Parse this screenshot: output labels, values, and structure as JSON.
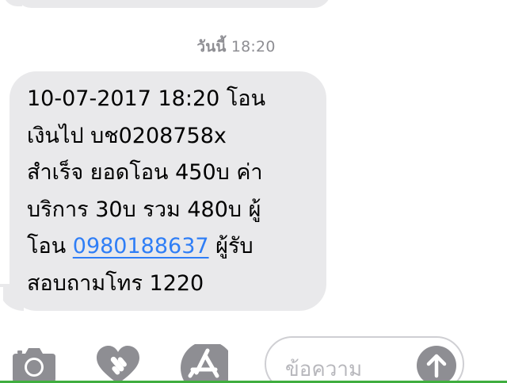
{
  "conversation": {
    "timestamp": {
      "day": "วันนี้",
      "time": "18:20"
    },
    "message": {
      "lines": [
        "10-07-2017 18:20 โอน",
        "เงินไป บช0208758x",
        "สำเร็จ ยอดโอน 450บ ค่า",
        "บริการ 30บ รวม 480บ ผู้"
      ],
      "line5_prefix": "โอน ",
      "phone_link": "0980188637",
      "line5_suffix": " ผู้รับ",
      "line6": "สอบถามโทร 1220"
    }
  },
  "toolbar": {
    "camera_icon": "camera-icon",
    "digital_touch_icon": "heart-digital-touch-icon",
    "app_store_icon": "app-store-icon",
    "input_placeholder": "ข้อความ",
    "send_icon": "arrow-up-icon"
  },
  "colors": {
    "bubble": "#e9e9eb",
    "link": "#2f7ef6",
    "timestamp": "#8e8e93",
    "icon": "#8e8e93"
  }
}
